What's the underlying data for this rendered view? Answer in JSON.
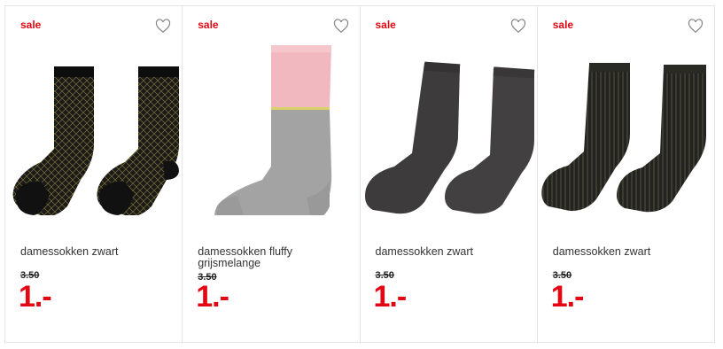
{
  "products": [
    {
      "badge": "sale",
      "title": "damessokken zwart",
      "old_price": "3.50",
      "price": "1.-",
      "favorite_icon": "heart-outline-icon",
      "image": "black-gold-patterned-socks"
    },
    {
      "badge": "sale",
      "title": "damessokken fluffy grijsmelange",
      "old_price": "3.50",
      "price": "1.-",
      "favorite_icon": "heart-outline-icon",
      "image": "grey-pink-fluffy-sock"
    },
    {
      "badge": "sale",
      "title": "damessokken zwart",
      "old_price": "3.50",
      "price": "1.-",
      "favorite_icon": "heart-outline-icon",
      "image": "dark-grey-glitter-socks"
    },
    {
      "badge": "sale",
      "title": "damessokken zwart",
      "old_price": "3.50",
      "price": "1.-",
      "favorite_icon": "heart-outline-icon",
      "image": "black-gold-ribbed-socks"
    }
  ],
  "colors": {
    "sale_red": "#e30613",
    "text": "#333333"
  }
}
